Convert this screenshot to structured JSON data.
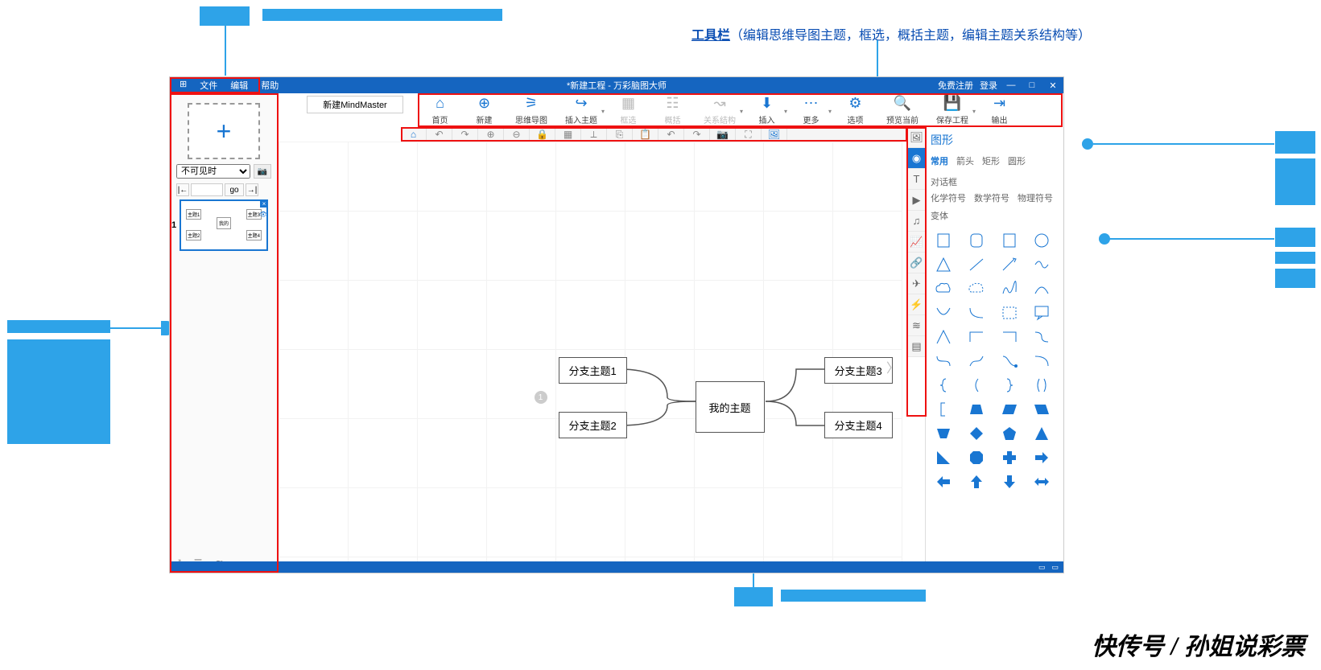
{
  "callouts": {
    "toolbar_main": "工具栏",
    "toolbar_sub": "（编辑思维导图主题，框选，概括主题，编辑主题关系结构等）"
  },
  "titlebar": {
    "menu": [
      "文件",
      "编辑",
      "帮助"
    ],
    "title": "*新建工程 - 万彩脑图大师",
    "free_reg": "免费注册",
    "login": "登录"
  },
  "tab": {
    "label": "新建MindMaster"
  },
  "toolbar": [
    {
      "label": "首页"
    },
    {
      "label": "新建"
    },
    {
      "label": "思维导图"
    },
    {
      "label": "插入主题",
      "drop": true
    },
    {
      "label": "框选",
      "dis": true
    },
    {
      "label": "概括",
      "dis": true
    },
    {
      "label": "关系结构",
      "drop": true,
      "dis": true
    },
    {
      "label": "插入",
      "drop": true
    },
    {
      "label": "更多",
      "drop": true
    },
    {
      "label": "选项"
    },
    {
      "label": "预览当前"
    },
    {
      "label": "保存工程",
      "drop": true
    },
    {
      "label": "输出"
    }
  ],
  "left": {
    "visibility": "不可见时",
    "go": "go",
    "slide_num": "1"
  },
  "mindmap": {
    "center": "我的主题",
    "tl": "分支主题1",
    "bl": "分支主题2",
    "tr": "分支主题3",
    "br": "分支主题4",
    "marker": "1"
  },
  "right": {
    "title": "图形",
    "tabs1": [
      "常用",
      "箭头",
      "矩形",
      "圆形",
      "对话框"
    ],
    "tabs2": [
      "化学符号",
      "数学符号",
      "物理符号"
    ],
    "tabs3": [
      "变体"
    ]
  },
  "watermark": {
    "a": "快传号",
    "sep": " / ",
    "b": "孙姐说彩票"
  }
}
